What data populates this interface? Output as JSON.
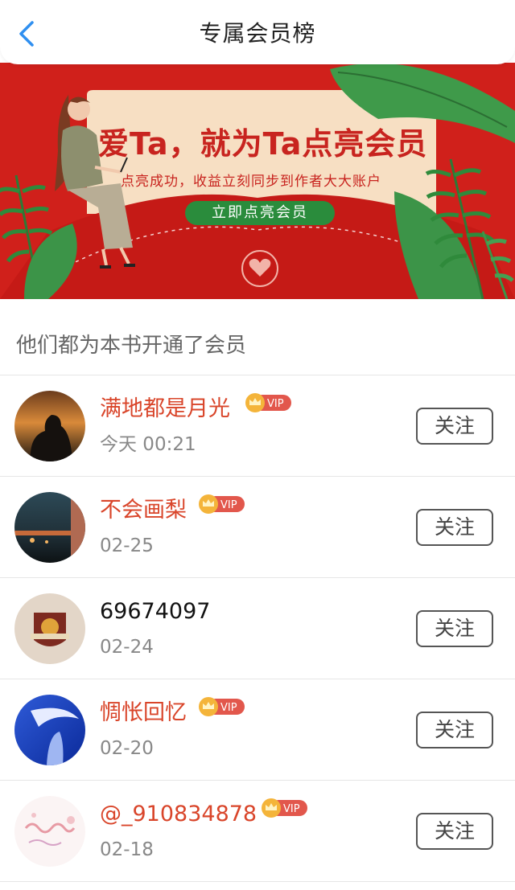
{
  "header": {
    "title": "专属会员榜"
  },
  "banner": {
    "headline": "爱Ta，就为Ta点亮会员",
    "subtitle": "点亮成功，收益立刻同步到作者大大账户",
    "cta_label": "立即点亮会员"
  },
  "section": {
    "title": "他们都为本书开通了会员"
  },
  "vip_badge_text": "VIP",
  "follow_label": "关注",
  "members": [
    {
      "name": "满地都是月光",
      "time": "今天 00:21",
      "vip": true
    },
    {
      "name": "不会画梨",
      "time": "02-25",
      "vip": true
    },
    {
      "name": "69674097",
      "time": "02-24",
      "vip": false
    },
    {
      "name": "惆怅回忆",
      "time": "02-20",
      "vip": true
    },
    {
      "name": "@_910834878",
      "time": "02-18",
      "vip": true
    }
  ],
  "colors": {
    "accent_red": "#c8241f",
    "vip_name": "#d9452a",
    "back_arrow": "#2f8ff0",
    "cta_green": "#2a8c3c"
  }
}
